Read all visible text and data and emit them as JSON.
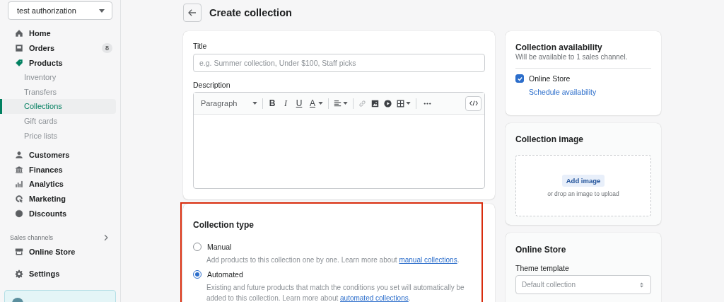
{
  "store_selector": {
    "label": "test authorization"
  },
  "nav_groups": [
    {
      "items": [
        {
          "label": "Home",
          "selected": false
        },
        {
          "label": "Orders",
          "badge": "8",
          "selected": false
        },
        {
          "label": "Products",
          "selected": false,
          "children": [
            {
              "label": "Inventory",
              "selected": false
            },
            {
              "label": "Transfers",
              "selected": false
            },
            {
              "label": "Collections",
              "selected": true
            },
            {
              "label": "Gift cards",
              "selected": false
            },
            {
              "label": "Price lists",
              "selected": false
            }
          ]
        }
      ]
    },
    {
      "items": [
        {
          "label": "Customers",
          "selected": false
        },
        {
          "label": "Finances",
          "selected": false
        },
        {
          "label": "Analytics",
          "selected": false
        },
        {
          "label": "Marketing",
          "selected": false
        },
        {
          "label": "Discounts",
          "selected": false
        }
      ]
    }
  ],
  "sales_channels": {
    "heading": "Sales channels",
    "items": [
      {
        "label": "Online Store",
        "selected": false
      }
    ]
  },
  "settings": {
    "label": "Settings",
    "selected": false
  },
  "page": {
    "title": "Create collection"
  },
  "details_card": {
    "title_label": "Title",
    "title_placeholder": "e.g. Summer collection, Under $100, Staff picks",
    "description_label": "Description",
    "block_format": "Paragraph",
    "format_buttons": [
      "B",
      "I",
      "U",
      "A"
    ]
  },
  "collection_type": {
    "heading": "Collection type",
    "options": [
      {
        "label": "Manual",
        "selected": false,
        "description": "Add products to this collection one by one. Learn more about ",
        "link": "manual collections",
        "after": "."
      },
      {
        "label": "Automated",
        "selected": true,
        "description": "Existing and future products that match the conditions you set will automatically be added to this collection. Learn more about ",
        "link": "automated collections",
        "after": "."
      }
    ]
  },
  "availability": {
    "title": "Collection availability",
    "subtitle": "Will be available to 1 sales channel.",
    "channels": [
      {
        "label": "Online Store",
        "checked": true
      }
    ],
    "link": "Schedule availability"
  },
  "image_card": {
    "title": "Collection image",
    "button": "Add image",
    "hint": "or drop an image to upload"
  },
  "online_store_card": {
    "title": "Online Store",
    "template_label": "Theme template",
    "template_value": "Default collection"
  }
}
